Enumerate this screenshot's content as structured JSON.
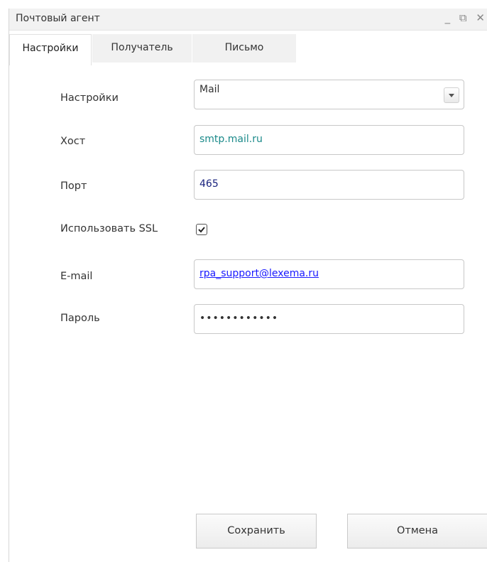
{
  "window": {
    "title": "Почтовый агент",
    "controls": {
      "minimize": "_",
      "restore": "⧉",
      "close": "✕"
    }
  },
  "tabs": [
    {
      "label": "Настройки",
      "active": true
    },
    {
      "label": "Получатель",
      "active": false
    },
    {
      "label": "Письмо",
      "active": false
    }
  ],
  "form": {
    "settings": {
      "label": "Настройки",
      "value": "Mail"
    },
    "host": {
      "label": "Хост",
      "value": "smtp.mail.ru"
    },
    "port": {
      "label": "Порт",
      "value": "465"
    },
    "ssl": {
      "label": "Использовать SSL",
      "checked": true
    },
    "email": {
      "label": "E-mail",
      "value": "rpa_support@lexema.ru"
    },
    "password": {
      "label": "Пароль",
      "value": "••••••••••••"
    }
  },
  "buttons": {
    "save": "Сохранить",
    "cancel": "Отмена"
  },
  "colors": {
    "host_text": "#1b8a8a",
    "port_text": "#1a237e",
    "email_link": "#1a1aff"
  }
}
